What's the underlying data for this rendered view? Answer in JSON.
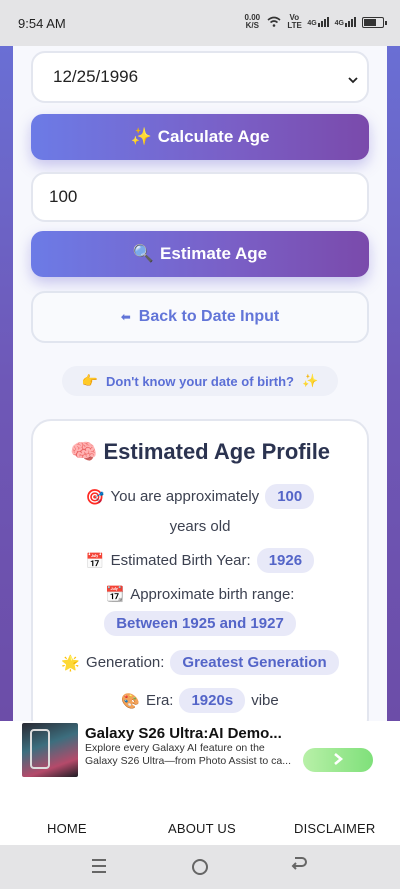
{
  "status_bar": {
    "time": "9:54 AM",
    "speed": "0.00 K/S",
    "net1": "Vo LTE",
    "net2": "4G",
    "net3": "4G"
  },
  "form": {
    "date_value": "12/25/1996",
    "calculate_button": "Calculate Age",
    "calculate_icon": "✨",
    "age_input_value": "100",
    "estimate_button": "Estimate Age",
    "estimate_icon": "🔍",
    "back_button": "Back to Date Input",
    "back_icon": "⬅",
    "dob_hint": "Don't know your date of birth?",
    "dob_hint_icon_left": "👉",
    "dob_hint_icon_right": "✨"
  },
  "profile": {
    "title": "Estimated Age Profile",
    "title_icon": "🧠",
    "approx_prefix": "You are approximately",
    "approx_icon": "🎯",
    "approx_value": "100",
    "approx_suffix": "years old",
    "birth_year_label": "Estimated Birth Year:",
    "birth_year_icon": "📅",
    "birth_year_value": "1926",
    "range_label": "Approximate birth range:",
    "range_icon": "📆",
    "range_value": "Between 1925 and 1927",
    "generation_label": "Generation:",
    "generation_icon": "🌟",
    "generation_value": "Greatest Generation",
    "era_label": "Era:",
    "era_icon": "🎨",
    "era_value": "1920s",
    "era_suffix": "vibe"
  },
  "ad": {
    "title": "Galaxy S26 Ultra:AI Demo...",
    "description": "Explore every Galaxy AI feature on the Galaxy S26 Ultra—from Photo Assist to ca...",
    "cta_icon": "chevron-right-icon"
  },
  "footer": {
    "links": [
      "HOME",
      "ABOUT US",
      "DISCLAIMER"
    ]
  }
}
